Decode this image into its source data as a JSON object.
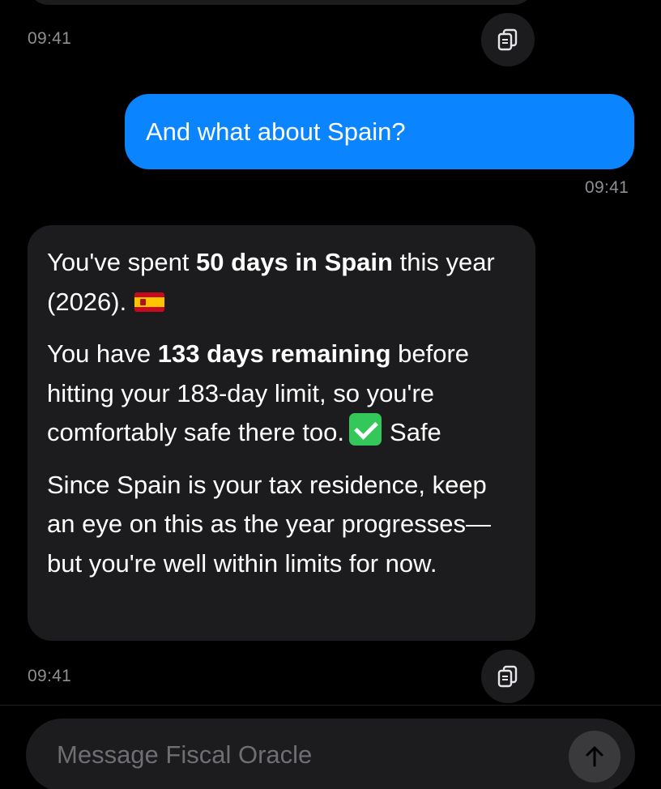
{
  "messages": [
    {
      "role": "assistant",
      "timestamp": "09:41"
    },
    {
      "role": "user",
      "text": "And what about Spain?",
      "timestamp": "09:41"
    },
    {
      "role": "assistant",
      "p1": {
        "a": "You've spent ",
        "b": "50 days in Spain",
        "c": " this year (2026)."
      },
      "p2": {
        "a": "You have ",
        "b": "133 days remaining",
        "c": " before hitting your 183-day limit, so you're comfortably safe there too.",
        "status": "Safe"
      },
      "p3": "Since Spain is your tax residence, keep an eye on this as the year progresses—but you're well within limits for now.",
      "timestamp": "09:41"
    }
  ],
  "icons": {
    "copy": "copy-icon",
    "flag": "spain-flag-icon",
    "check": "check-mark-icon",
    "send": "arrow-up-icon"
  },
  "composer": {
    "placeholder": "Message Fiscal Oracle"
  },
  "colors": {
    "background": "#000000",
    "user_bubble": "#0a84ff",
    "assistant_bubble": "#1c1c1e",
    "timestamp": "#8e8e93",
    "safe_check": "#34c759"
  }
}
